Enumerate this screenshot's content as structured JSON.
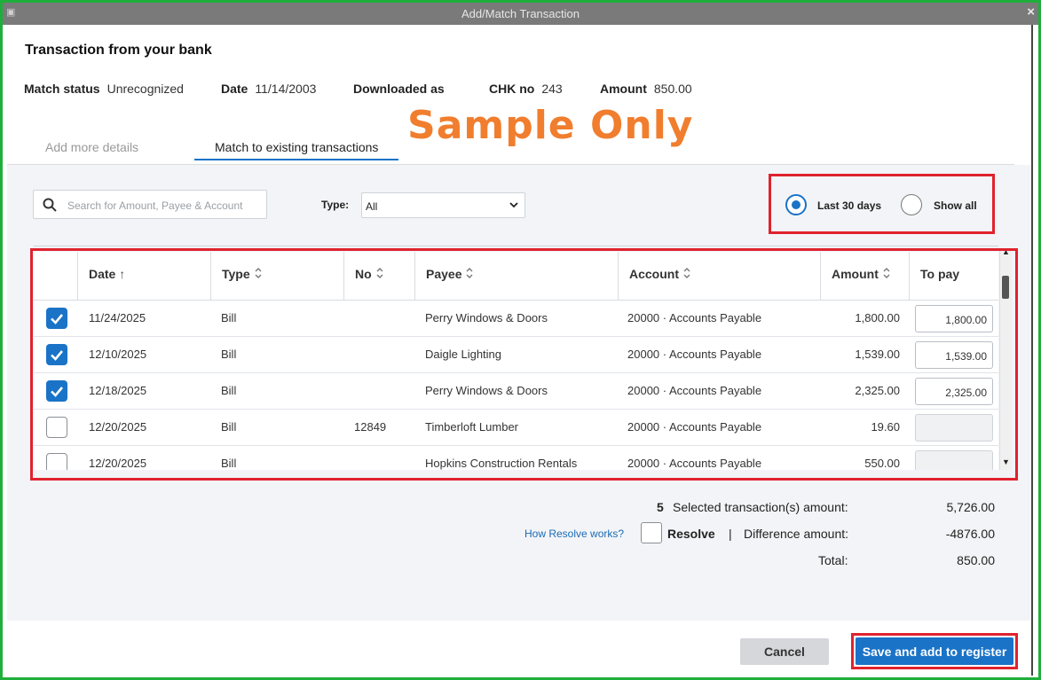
{
  "window": {
    "title": "Add/Match Transaction",
    "close_label": "×",
    "system_icon": "▣"
  },
  "header": {
    "title": "Transaction from your bank",
    "match_status_label": "Match status",
    "match_status_value": "Unrecognized",
    "date_label": "Date",
    "date_value": "11/14/2003",
    "downloaded_as_label": "Downloaded as",
    "chk_label": "CHK no",
    "chk_value": "243",
    "amount_label": "Amount",
    "amount_value": "850.00"
  },
  "watermark": "Sample Only",
  "tabs": [
    {
      "label": "Add more details",
      "active": false
    },
    {
      "label": "Match to existing transactions",
      "active": true
    }
  ],
  "filters": {
    "search_placeholder": "Search for Amount, Payee & Account",
    "search_value": "",
    "type_label": "Type:",
    "type_value": "All",
    "range_options": [
      {
        "label": "Last 30 days",
        "selected": true
      },
      {
        "label": "Show all",
        "selected": false
      }
    ]
  },
  "table": {
    "columns": [
      "Date",
      "Type",
      "No",
      "Payee",
      "Account",
      "Amount",
      "To pay"
    ],
    "sort_indicator": "↑",
    "rows": [
      {
        "checked": true,
        "date": "11/24/2025",
        "type": "Bill",
        "no": "",
        "payee": "Perry Windows & Doors",
        "account": "20000 · Accounts Payable",
        "amount": "1,800.00",
        "to_pay": "1,800.00"
      },
      {
        "checked": true,
        "date": "12/10/2025",
        "type": "Bill",
        "no": "",
        "payee": "Daigle Lighting",
        "account": "20000 · Accounts Payable",
        "amount": "1,539.00",
        "to_pay": "1,539.00"
      },
      {
        "checked": true,
        "date": "12/18/2025",
        "type": "Bill",
        "no": "",
        "payee": "Perry Windows & Doors",
        "account": "20000 · Accounts Payable",
        "amount": "2,325.00",
        "to_pay": "2,325.00"
      },
      {
        "checked": false,
        "date": "12/20/2025",
        "type": "Bill",
        "no": "12849",
        "payee": "Timberloft Lumber",
        "account": "20000 · Accounts Payable",
        "amount": "19.60",
        "to_pay": ""
      },
      {
        "checked": false,
        "date": "12/20/2025",
        "type": "Bill",
        "no": "",
        "payee": "Hopkins Construction Rentals",
        "account": "20000 · Accounts Payable",
        "amount": "550.00",
        "to_pay": ""
      }
    ]
  },
  "summary": {
    "selected_count": "5",
    "selected_label": "Selected transaction(s) amount:",
    "selected_value": "5,726.00",
    "how_resolve_link": "How Resolve works?",
    "resolve_label": "Resolve",
    "separator": "|",
    "difference_label": "Difference amount:",
    "difference_value": "-4876.00",
    "total_label": "Total:",
    "total_value": "850.00"
  },
  "footer": {
    "cancel_label": "Cancel",
    "save_label": "Save and add to register"
  },
  "colors": {
    "accent": "#1a73c7",
    "highlight_box": "#e0222e",
    "frame": "#1fae3b",
    "watermark": "#f07e2e"
  }
}
